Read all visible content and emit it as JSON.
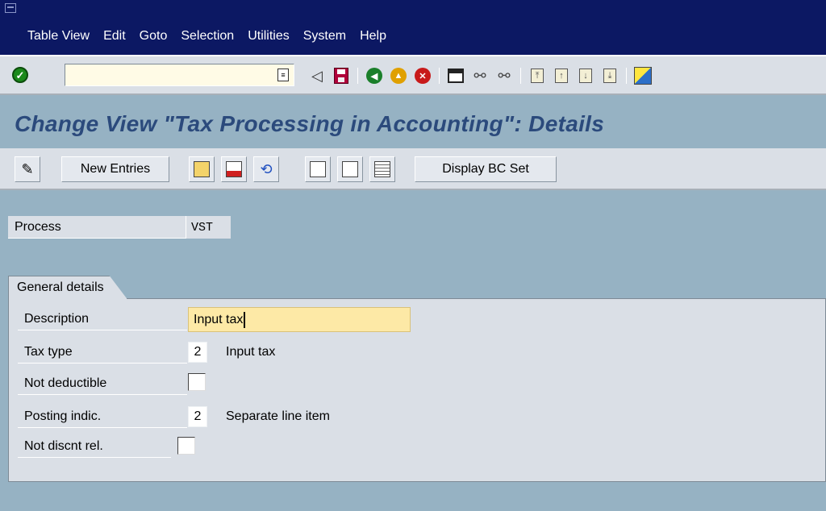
{
  "menu": {
    "items": [
      {
        "label": "Table View"
      },
      {
        "label": "Edit"
      },
      {
        "label": "Goto"
      },
      {
        "label": "Selection"
      },
      {
        "label": "Utilities"
      },
      {
        "label": "System"
      },
      {
        "label": "Help"
      }
    ]
  },
  "toolbar": {
    "command_value": "",
    "icons": [
      "enter-icon",
      "command-field",
      "back-arrow-icon",
      "save-icon",
      "back-icon",
      "exit-icon",
      "cancel-icon",
      "print-icon",
      "find-icon",
      "find-next-icon",
      "first-page-icon",
      "previous-page-icon",
      "next-page-icon",
      "last-page-icon",
      "customize-layout-icon"
    ]
  },
  "page": {
    "title": "Change View \"Tax Processing in Accounting\": Details"
  },
  "app_toolbar": {
    "new_entries_label": "New Entries",
    "display_bc_set_label": "Display BC Set"
  },
  "header": {
    "process_label": "Process",
    "process_value": "VST"
  },
  "general": {
    "tab_label": "General details",
    "description_label": "Description",
    "description_value": "Input tax",
    "tax_type_label": "Tax type",
    "tax_type_code": "2",
    "tax_type_text": "Input tax",
    "not_deductible_label": "Not deductible",
    "posting_indic_label": "Posting indic.",
    "posting_indic_code": "2",
    "posting_indic_text": "Separate line item",
    "not_discnt_rel_label": "Not discnt rel."
  },
  "colors": {
    "menubar_bg": "#0c1863",
    "content_bg": "#96b2c3",
    "title_color": "#2b4a7c",
    "input_focus_bg": "#fde9a6"
  }
}
